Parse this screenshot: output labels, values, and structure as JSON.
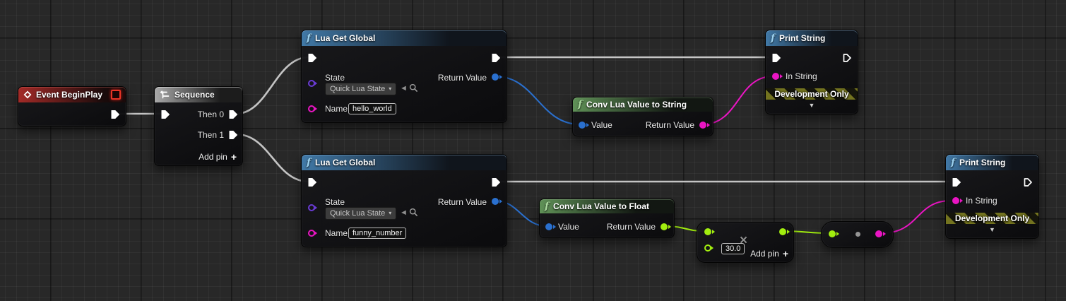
{
  "nodes": {
    "event_begin_play": {
      "title": "Event BeginPlay"
    },
    "sequence": {
      "title": "Sequence",
      "pin_then0": "Then 0",
      "pin_then1": "Then 1",
      "add_pin_label": "Add pin"
    },
    "lua_get_global_1": {
      "title": "Lua Get Global",
      "pin_state_label": "State",
      "state_dropdown_value": "Quick Lua State",
      "pin_name_label": "Name",
      "name_value": "hello_world",
      "pin_return_label": "Return Value"
    },
    "conv_to_string": {
      "title": "Conv Lua Value to String",
      "pin_value_label": "Value",
      "pin_return_label": "Return Value"
    },
    "print_string_1": {
      "title": "Print String",
      "pin_in_string_label": "In String",
      "dev_only_label": "Development Only"
    },
    "lua_get_global_2": {
      "title": "Lua Get Global",
      "pin_state_label": "State",
      "state_dropdown_value": "Quick Lua State",
      "pin_name_label": "Name",
      "name_value": "funny_number",
      "pin_return_label": "Return Value"
    },
    "conv_to_float": {
      "title": "Conv Lua Value to Float",
      "pin_value_label": "Value",
      "pin_return_label": "Return Value"
    },
    "multiply": {
      "operator_symbol": "×",
      "input_value": "30.0",
      "add_pin_label": "Add pin"
    },
    "print_string_2": {
      "title": "Print String",
      "pin_in_string_label": "In String",
      "dev_only_label": "Development Only"
    }
  },
  "icons": {
    "function_glyph": "f",
    "dropdown_caret": "▾",
    "collapse_caret": "▼",
    "use_selected_arrow": "◄",
    "plus": "+"
  },
  "colors": {
    "exec_wire": "#c4c4c4",
    "lua_value_pin": "#2a70cf",
    "string_pin": "#ea15c3",
    "float_pin": "#a2ee0f",
    "state_object_pin": "#6a3bd5",
    "header_function": "#4179a7",
    "header_pure_conv": "#5f9157",
    "header_event": "#a32a27",
    "dev_only_stripe": "#73731f"
  }
}
